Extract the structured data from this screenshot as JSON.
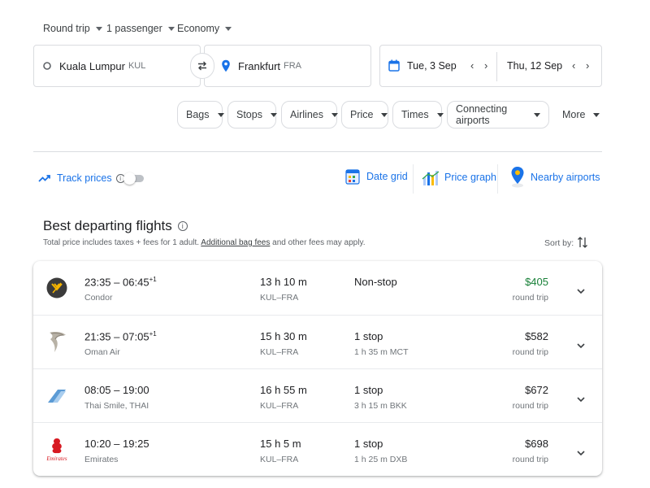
{
  "search": {
    "trip_type": "Round trip",
    "passengers": "1 passenger",
    "cabin": "Economy",
    "origin_city": "Kuala Lumpur",
    "origin_code": "KUL",
    "destination_city": "Frankfurt",
    "destination_code": "FRA",
    "depart_date": "Tue, 3 Sep",
    "return_date": "Thu, 12 Sep"
  },
  "filters": [
    "Bags",
    "Stops",
    "Airlines",
    "Price",
    "Times",
    "Connecting airports",
    "More"
  ],
  "tools": {
    "track_prices": "Track prices",
    "track_enabled": false,
    "date_grid": "Date grid",
    "price_graph": "Price graph",
    "nearby_airports": "Nearby airports"
  },
  "results": {
    "heading": "Best departing flights",
    "subtitle_prefix": "Total price includes taxes + fees for 1 adult.",
    "subtitle_link": "Additional bag fees",
    "subtitle_suffix": "and other fees may apply.",
    "sort_label": "Sort by:",
    "flights": [
      {
        "dep": "23:35",
        "arr": "06:45",
        "plus": "+1",
        "airline": "Condor",
        "duration": "13 h 10 m",
        "route": "KUL–FRA",
        "stops": "Non-stop",
        "layover": "",
        "price": "$405",
        "price_note": "round trip",
        "cheapest": true,
        "logo": "condor-logo"
      },
      {
        "dep": "21:35",
        "arr": "07:05",
        "plus": "+1",
        "airline": "Oman Air",
        "duration": "15 h 30 m",
        "route": "KUL–FRA",
        "stops": "1 stop",
        "layover": "1 h 35 m MCT",
        "price": "$582",
        "price_note": "round trip",
        "cheapest": false,
        "logo": "oman-air-logo"
      },
      {
        "dep": "08:05",
        "arr": "19:00",
        "plus": "",
        "airline": "Thai Smile, THAI",
        "duration": "16 h 55 m",
        "route": "KUL–FRA",
        "stops": "1 stop",
        "layover": "3 h 15 m BKK",
        "price": "$672",
        "price_note": "round trip",
        "cheapest": false,
        "logo": "thai-logo"
      },
      {
        "dep": "10:20",
        "arr": "19:25",
        "plus": "",
        "airline": "Emirates",
        "duration": "15 h 5 m",
        "route": "KUL–FRA",
        "stops": "1 stop",
        "layover": "1 h 25 m DXB",
        "price": "$698",
        "price_note": "round trip",
        "cheapest": false,
        "logo": "emirates-logo"
      }
    ]
  },
  "colors": {
    "accent": "#1a73e8",
    "cheap_price": "#188038",
    "condor_yellow": "#f5b400"
  }
}
